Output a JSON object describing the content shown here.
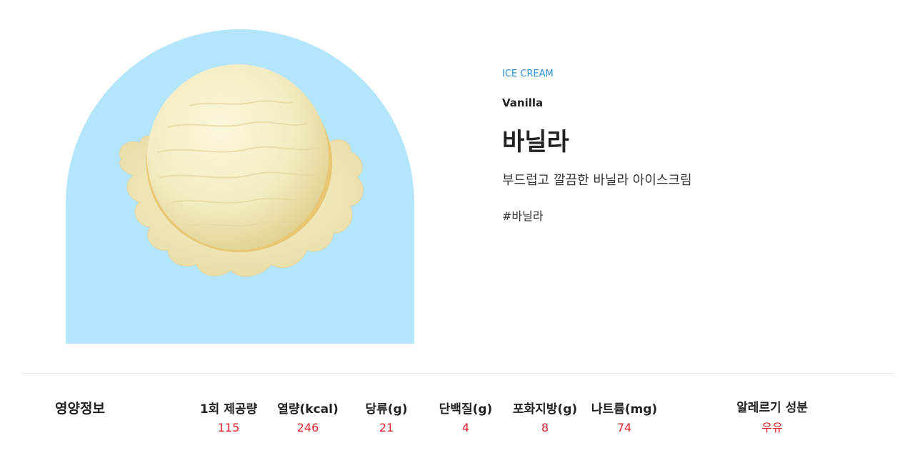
{
  "product": {
    "category": "ICE CREAM",
    "name_en": "Vanilla",
    "name_ko": "바닐라",
    "description": "부드럽고 깔끔한 바닐라 아이스크림",
    "hashtag": "#바닐라"
  },
  "nutrition": {
    "title": "영양정보",
    "columns": [
      {
        "header": "1회 제공량",
        "value": "115"
      },
      {
        "header": "열량(kcal)",
        "value": "246"
      },
      {
        "header": "당류(g)",
        "value": "21"
      },
      {
        "header": "단백질(g)",
        "value": "4"
      },
      {
        "header": "포화지방(g)",
        "value": "8"
      },
      {
        "header": "나트륨(mg)",
        "value": "74"
      }
    ],
    "allergy": {
      "header": "알레르기 성분",
      "value": "우유"
    }
  },
  "colors": {
    "hero_bg": "#b3e6fd",
    "category": "#2a8fd6",
    "value_red": "#e4202a",
    "scoop": "#f6efc6"
  }
}
